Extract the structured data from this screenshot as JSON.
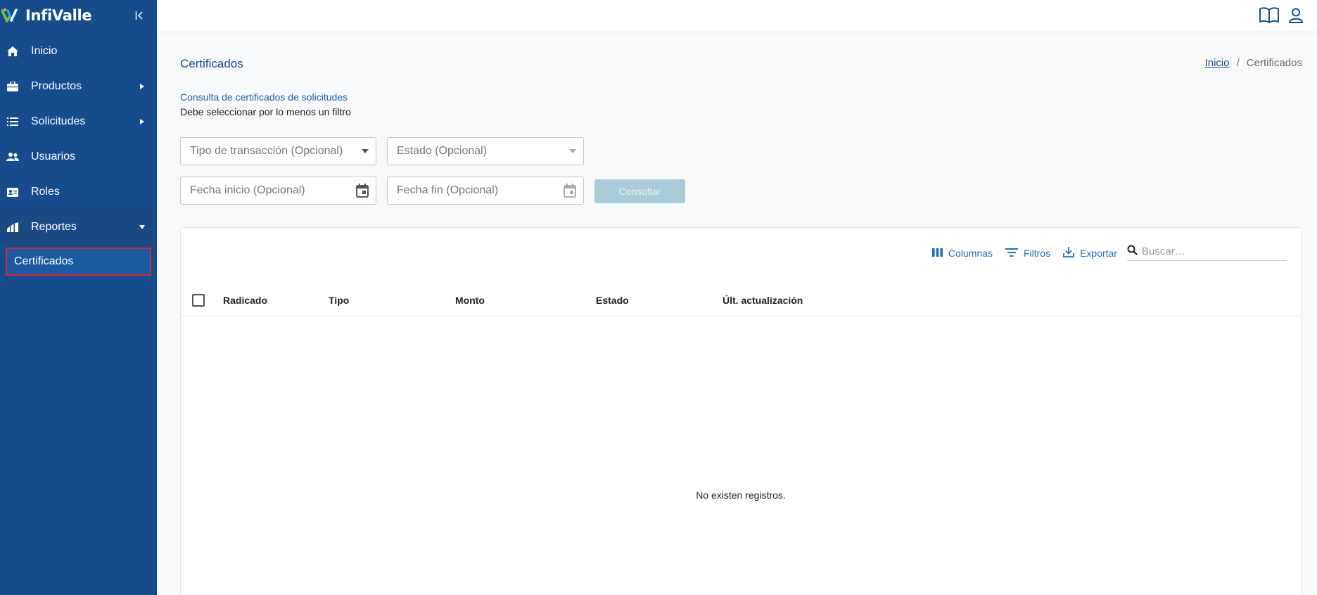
{
  "app": {
    "name": "InfiValle"
  },
  "sidebar": {
    "items": [
      {
        "label": "Inicio",
        "icon": "home-icon"
      },
      {
        "label": "Productos",
        "icon": "briefcase-icon"
      },
      {
        "label": "Solicitudes",
        "icon": "list-icon"
      },
      {
        "label": "Usuarios",
        "icon": "users-icon"
      },
      {
        "label": "Roles",
        "icon": "id-card-icon"
      },
      {
        "label": "Reportes",
        "icon": "chart-icon"
      }
    ],
    "sub_items": [
      {
        "label": "Certificados"
      }
    ]
  },
  "header": {
    "title": "Certificados",
    "breadcrumb": {
      "home": "Inicio",
      "separator": "/",
      "current": "Certificados"
    }
  },
  "filters": {
    "subtitle": "Consulta de certificados de solicitudes",
    "hint": "Debe seleccionar por lo menos un filtro",
    "tipo_placeholder": "Tipo de transacción (Opcional)",
    "estado_placeholder": "Estado (Opcional)",
    "fecha_inicio_placeholder": "Fecha inicio (Opcional)",
    "fecha_fin_placeholder": "Fecha fin (Opcional)",
    "consultar_label": "Consultar"
  },
  "table": {
    "toolbar": {
      "columns": "Columnas",
      "filters": "Filtros",
      "export": "Exportar",
      "search_placeholder": "Buscar…"
    },
    "columns": [
      "Radicado",
      "Tipo",
      "Monto",
      "Estado",
      "Últ. actualización"
    ],
    "empty_text": "No existen registros."
  },
  "colors": {
    "sidebar": "#144c8c",
    "accent": "#1f6fb0",
    "highlight_border": "#e3242b",
    "button_disabled": "#a8ccd8"
  }
}
